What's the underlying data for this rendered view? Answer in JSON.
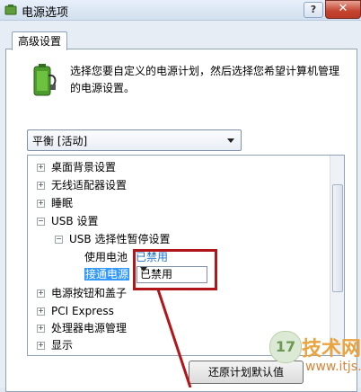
{
  "window": {
    "title": "电源选项",
    "help_label": "?",
    "close_label": "✕"
  },
  "tab": {
    "label": "高级设置"
  },
  "description": "选择您要自定义的电源计划，然后选择您希望计算机管理的电源设置。",
  "plan_select": {
    "value": "平衡 [活动]"
  },
  "tree": {
    "items": [
      {
        "label": "桌面背景设置",
        "expander": "+"
      },
      {
        "label": "无线适配器设置",
        "expander": "+"
      },
      {
        "label": "睡眠",
        "expander": "+"
      },
      {
        "label": "USB 设置",
        "expander": "−"
      },
      {
        "label": "USB 选择性暂停设置",
        "expander": "−"
      },
      {
        "label": "使用电池",
        "value": "已禁用"
      },
      {
        "label": "接通电源",
        "value": "已禁用"
      },
      {
        "label": "电源按钮和盖子",
        "expander": "+"
      },
      {
        "label": "PCI Express",
        "expander": "+"
      },
      {
        "label": "处理器电源管理",
        "expander": "+"
      },
      {
        "label": "显示",
        "expander": "+"
      }
    ]
  },
  "buttons": {
    "restore_label": "还原计划默认值"
  },
  "watermark": {
    "logo": "17",
    "text": "技术网",
    "url": "www.itjs.cn"
  },
  "colors": {
    "highlight": "#3399ff",
    "annotation": "#b0161a"
  }
}
